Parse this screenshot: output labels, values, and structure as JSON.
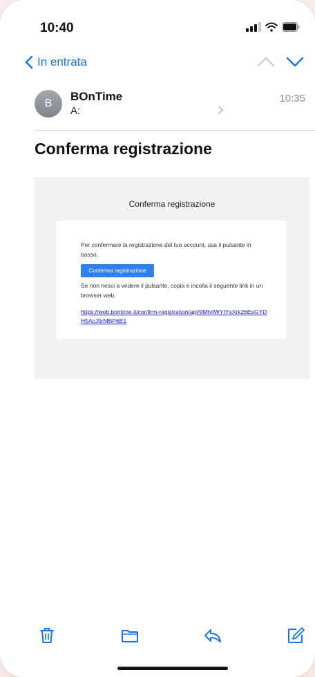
{
  "status_bar": {
    "time": "10:40"
  },
  "nav": {
    "back_label": "In entrata"
  },
  "message": {
    "avatar_initial": "B",
    "sender": "BOnTime",
    "to_label": "A:",
    "time": "10:35",
    "subject": "Conferma registrazione"
  },
  "email": {
    "title": "Conferma registrazione",
    "paragraph1": "Per confermare la registrazione del tuo account, usa il pulsante in basso.",
    "button_label": "Conferma registrazione",
    "paragraph2": "Se non riesci a vedere il pulsante, copia e incolla il seguente link in un browser web.",
    "link": "https://web.bontime.it/confirm-registration/api/9Mh4WYIYsXrk26EsGYDH5AcJ5rMBP6E1"
  },
  "colors": {
    "accent": "#1a73e8",
    "button": "#2f7ff0",
    "link": "#1a1ae6"
  },
  "icons": [
    "chevron-left-icon",
    "chevron-up-icon",
    "chevron-down-icon",
    "trash-icon",
    "folder-icon",
    "reply-icon",
    "compose-icon"
  ]
}
